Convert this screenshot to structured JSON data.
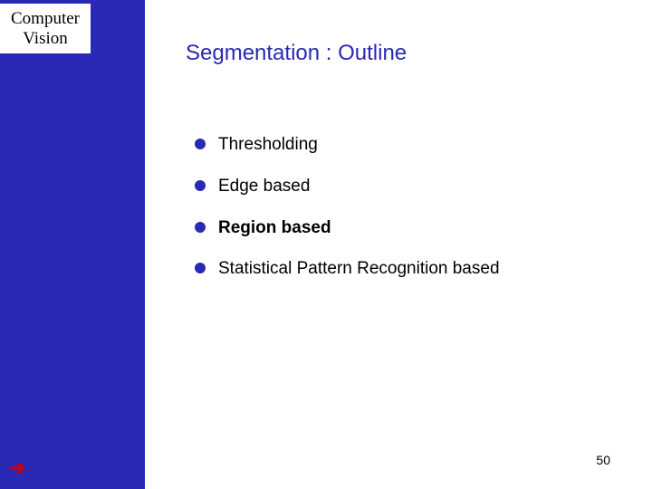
{
  "sidebar": {
    "title": "Computer Vision",
    "arrow_icon": "➔"
  },
  "slide": {
    "title": "Segmentation : Outline",
    "bullets": [
      {
        "text": "Thresholding",
        "emph": false
      },
      {
        "text": "Edge based",
        "emph": false
      },
      {
        "text": "Region based",
        "emph": true
      },
      {
        "text": "Statistical Pattern Recognition based",
        "emph": false
      }
    ],
    "page_number": "50"
  }
}
